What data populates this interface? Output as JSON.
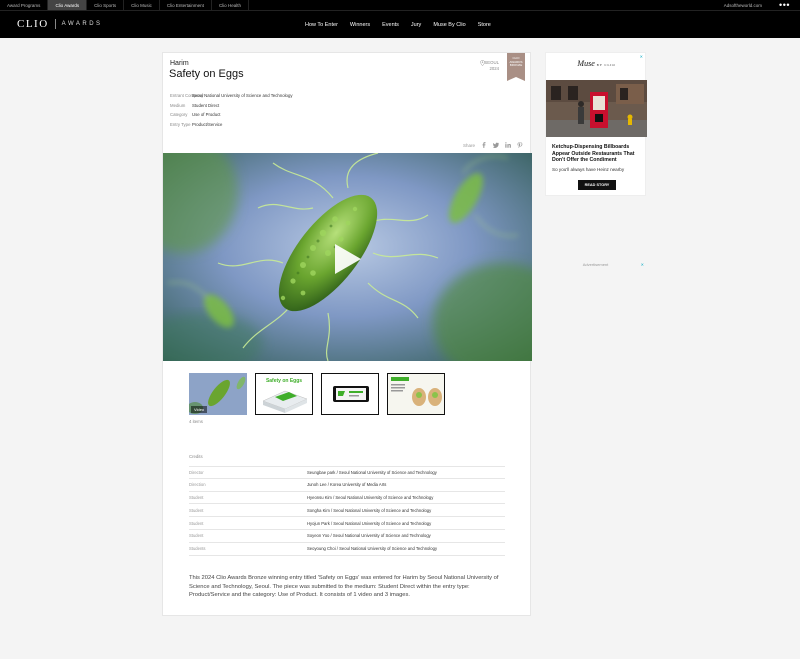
{
  "topbar": {
    "items": [
      "Award Programs",
      "Clio Awards",
      "Clio Sports",
      "Clio Music",
      "Clio Entertainment",
      "Clio Health"
    ],
    "active_index": 1,
    "right_link": "Adsoftheworld.com",
    "menu_icon": "more-dots-icon"
  },
  "logo": {
    "clio": "CLIO",
    "awards": "AWARDS"
  },
  "nav": [
    "How To Enter",
    "Winners",
    "Events",
    "Jury",
    "Muse By Clio",
    "Store"
  ],
  "entry": {
    "brand": "Harim",
    "title": "Safety on Eggs",
    "location": "SEOUL",
    "year": "2024",
    "badge": [
      "CLIO",
      "AWARDS",
      "BRONZE"
    ],
    "badge_color": "#a98f85",
    "meta": [
      {
        "k": "Entrant Company",
        "v": "Seoul National University of Science and Technology"
      },
      {
        "k": "Medium",
        "v": "Student Direct"
      },
      {
        "k": "Category",
        "v": "Use of Product"
      },
      {
        "k": "Entry Type",
        "v": "Product/Service"
      }
    ],
    "share_label": "Share"
  },
  "media": {
    "thumb_video_label": "Video",
    "items_count": "4 items",
    "thumb1_title": "Safety on Eggs"
  },
  "credits": {
    "title": "Credits",
    "rows": [
      {
        "role": "Director",
        "name": "Seungbae park / Seoul National University of Science and Technology"
      },
      {
        "role": "Direction",
        "name": "Junoh Lee / Korea University of Media Arts"
      },
      {
        "role": "Student",
        "name": "Hyeonsu Kim / Seoul National University of Science and Technology"
      },
      {
        "role": "Student",
        "name": "Songha Kim / Seoul National University of Science and Technology"
      },
      {
        "role": "Student",
        "name": "Hyojun Park / Seoul National University of Science and Technology"
      },
      {
        "role": "Student",
        "name": "Soyeon Yoo / Seoul National University of Science and Technology"
      },
      {
        "role": "Students",
        "name": "Seoyoung Choi / Seoul National University of Science and Technology"
      }
    ]
  },
  "description": "This 2024 Clio Awards Bronze winning entry titled 'Safety on Eggs' was entered for Harim by Seoul National University of Science and Technology, Seoul. The piece was submitted to the medium: Student Direct within the entry type: Product/Service and the category: Use of Product. It consists of 1 video and 3 images.",
  "ad1": {
    "brand": "Muse",
    "brand_sub": "BY CLIO",
    "headline": "Ketchup-Dispensing Billboards Appear Outside Restaurants That Don't Offer the Condiment",
    "subline": "So you'll always have Heinz nearby",
    "cta": "READ STORY",
    "close": "✕"
  },
  "ad2": {
    "label": "Advertisement",
    "close": "✕"
  }
}
